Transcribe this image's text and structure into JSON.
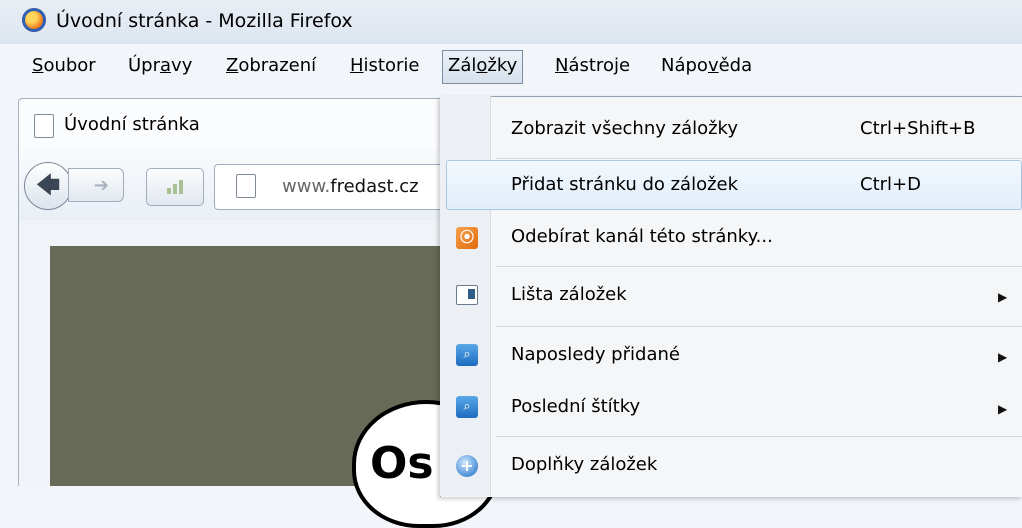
{
  "window": {
    "title": "Úvodní stránka - Mozilla Firefox"
  },
  "menubar": {
    "items": [
      "Soubor",
      "Úpravy",
      "Zobrazení",
      "Historie",
      "Záložky",
      "Nástroje",
      "Nápověda"
    ],
    "active": "Záložky"
  },
  "tab": {
    "label": "Úvodní stránka"
  },
  "navigation": {
    "url_prefix": "www.",
    "url_domain": "fredast.cz"
  },
  "content": {
    "bubble_text": "Os"
  },
  "bookmarks_menu": {
    "items": [
      {
        "label": "Zobrazit všechny záložky",
        "shortcut": "Ctrl+Shift+B",
        "icon": "none"
      },
      {
        "label": "Přidat stránku do záložek",
        "shortcut": "Ctrl+D",
        "icon": "none",
        "highlighted": true
      },
      {
        "label": "Odebírat kanál této stránky...",
        "icon": "rss-icon"
      },
      {
        "label": "Lišta záložek",
        "icon": "bookmarks-toolbar-icon",
        "submenu": true
      },
      {
        "label": "Naposledy přidané",
        "icon": "search-bookmarks-icon",
        "submenu": true
      },
      {
        "label": "Poslední štítky",
        "icon": "search-bookmarks-icon",
        "submenu": true
      },
      {
        "label": "Doplňky záložek",
        "icon": "addon-icon"
      }
    ]
  },
  "icons": {
    "submenu_arrow": "▶",
    "back_arrow": "🡄",
    "forward_arrow": "➔"
  }
}
